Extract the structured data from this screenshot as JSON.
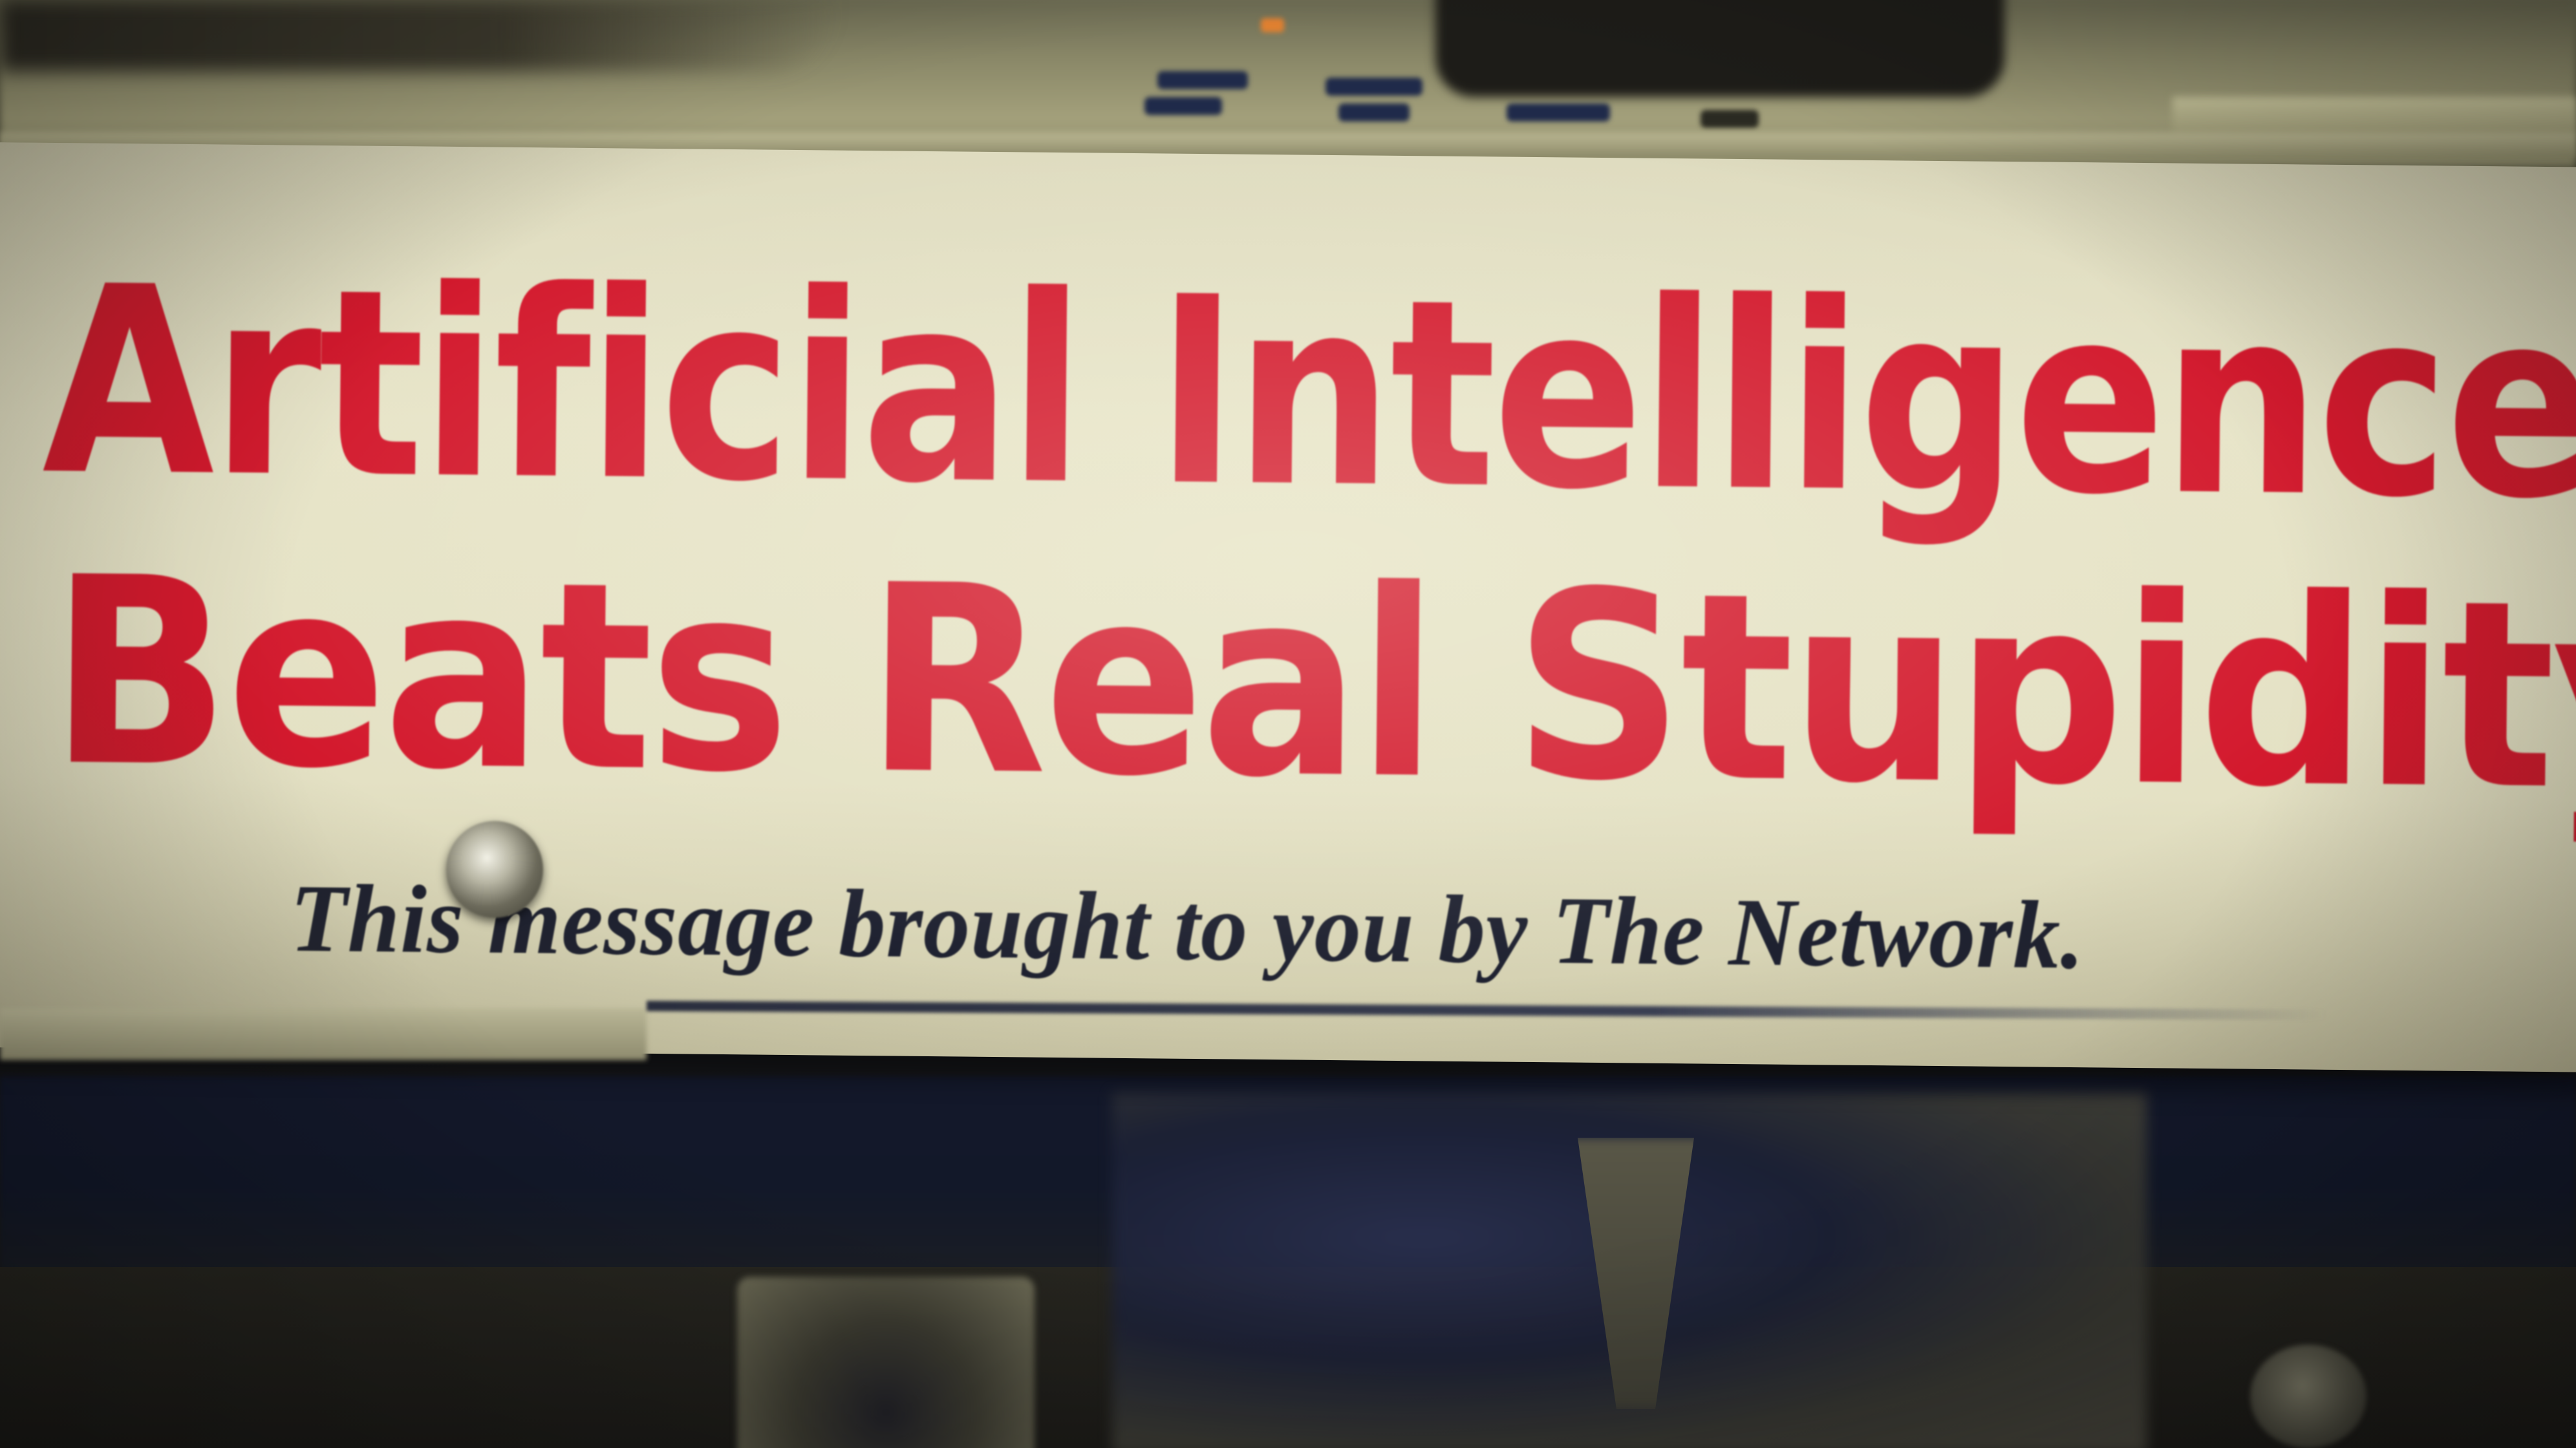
{
  "sticker": {
    "headline_line1": "Artificial Intelligence",
    "headline_line2": "Beats Real Stupidity",
    "tagline": "This message brought to you by The Network."
  },
  "colors": {
    "headline": "#d3192d",
    "tagline": "#1e2130",
    "sticker_background": "#e4e1c4"
  }
}
